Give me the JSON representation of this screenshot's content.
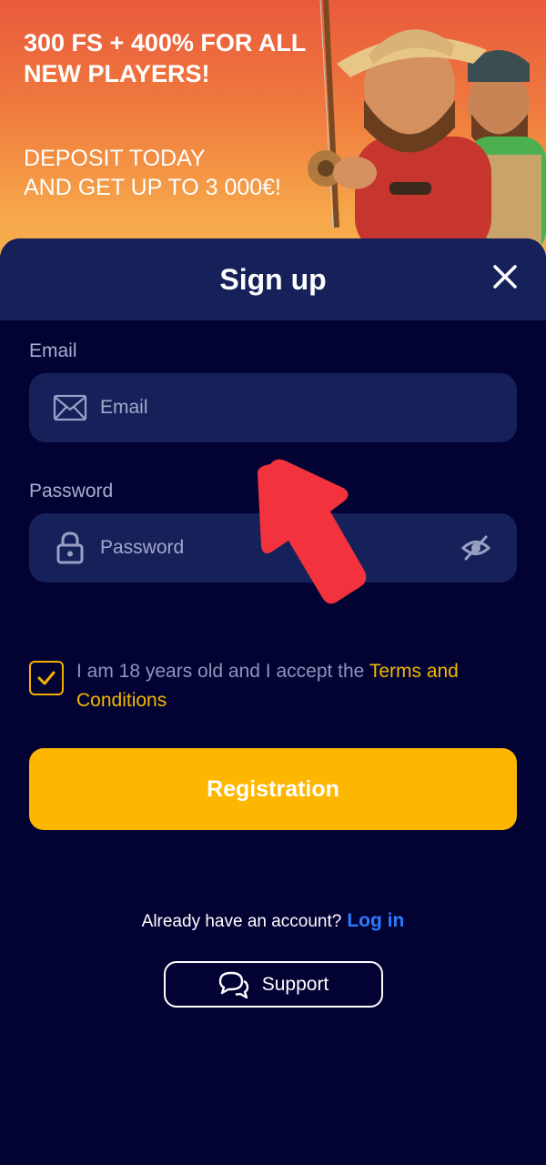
{
  "banner": {
    "title": "300 FS + 400% FOR ALL NEW PLAYERS!",
    "subtitle_line1": "DEPOSIT TODAY",
    "subtitle_line2": "AND GET UP TO 3 000€!"
  },
  "signup": {
    "title": "Sign up",
    "email_label": "Email",
    "email_placeholder": "Email",
    "email_value": "",
    "password_label": "Password",
    "password_placeholder": "Password",
    "password_value": "",
    "consent_text": "I am 18 years old and I accept the ",
    "consent_link": "Terms and Conditions",
    "consent_checked": true,
    "register_label": "Registration",
    "account_prompt": "Already have an account?",
    "login_label": "Log in",
    "support_label": "Support"
  },
  "icons": {
    "close": "close-icon",
    "email": "mail-icon",
    "password": "lock-icon",
    "visibility": "eye-off-icon",
    "checkbox": "checkmark-icon",
    "support": "chat-bubbles-icon",
    "overlay": "arrow-pointer"
  },
  "colors": {
    "background": "#020233",
    "header": "#16215a",
    "field": "#16215a",
    "accent": "#fdb700",
    "link": "#2e7bff",
    "arrow": "#f2333d"
  }
}
